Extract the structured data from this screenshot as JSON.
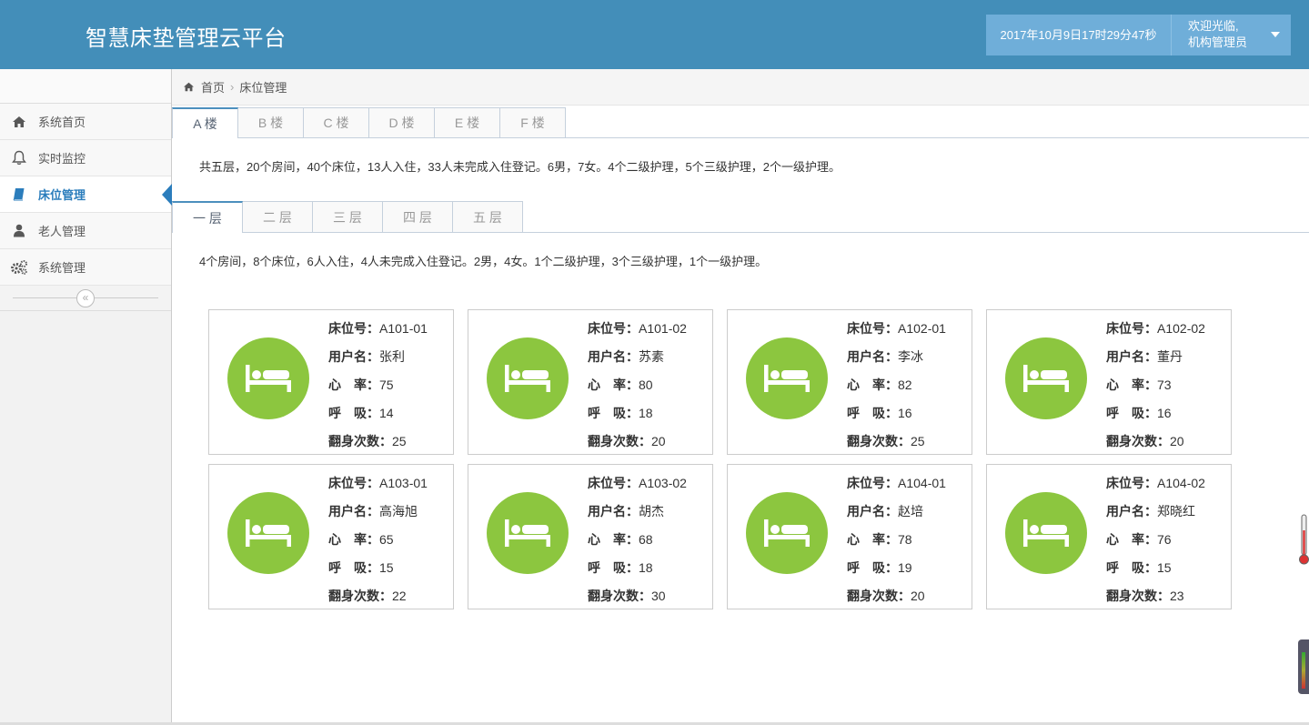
{
  "header": {
    "title": "智慧床垫管理云平台",
    "datetime": "2017年10月9日17时29分47秒",
    "welcome": "欢迎光临,",
    "user_role": "机构管理员"
  },
  "sidebar": {
    "items": [
      {
        "label": "系统首页",
        "icon": "home-icon"
      },
      {
        "label": "实时监控",
        "icon": "bell-icon"
      },
      {
        "label": "床位管理",
        "icon": "book-icon",
        "active": true
      },
      {
        "label": "老人管理",
        "icon": "user-icon"
      },
      {
        "label": "系统管理",
        "icon": "gears-icon"
      }
    ],
    "collapse_label": "«"
  },
  "breadcrumb": {
    "home": "首页",
    "current": "床位管理"
  },
  "building_tabs": [
    "A 楼",
    "B 楼",
    "C 楼",
    "D 楼",
    "E 楼",
    "F 楼"
  ],
  "building_summary": "共五层，20个房间，40个床位，13人入住，33人未完成入住登记。6男，7女。4个二级护理，5个三级护理，2个一级护理。",
  "floor_tabs": [
    "一 层",
    "二 层",
    "三 层",
    "四 层",
    "五 层"
  ],
  "floor_summary": "4个房间，8个床位，6人入住，4人未完成入住登记。2男，4女。1个二级护理，3个三级护理，1个一级护理。",
  "field_labels": {
    "bed_no": "床位号：",
    "user_name": "用户名：",
    "heart_rate": "心　率：",
    "breath": "呼　吸：",
    "turns": "翻身次数："
  },
  "accent_color": "#8cc63f",
  "beds": [
    {
      "bed_no": "A101-01",
      "user_name": "张利",
      "heart_rate": "75",
      "breath": "14",
      "turns": "25"
    },
    {
      "bed_no": "A101-02",
      "user_name": "苏素",
      "heart_rate": "80",
      "breath": "18",
      "turns": "20"
    },
    {
      "bed_no": "A102-01",
      "user_name": "李冰",
      "heart_rate": "82",
      "breath": "16",
      "turns": "25"
    },
    {
      "bed_no": "A102-02",
      "user_name": "董丹",
      "heart_rate": "73",
      "breath": "16",
      "turns": "20"
    },
    {
      "bed_no": "A103-01",
      "user_name": "高海旭",
      "heart_rate": "65",
      "breath": "15",
      "turns": "22"
    },
    {
      "bed_no": "A103-02",
      "user_name": "胡杰",
      "heart_rate": "68",
      "breath": "18",
      "turns": "30"
    },
    {
      "bed_no": "A104-01",
      "user_name": "赵培",
      "heart_rate": "78",
      "breath": "19",
      "turns": "20"
    },
    {
      "bed_no": "A104-02",
      "user_name": "郑晓红",
      "heart_rate": "76",
      "breath": "15",
      "turns": "23"
    }
  ]
}
